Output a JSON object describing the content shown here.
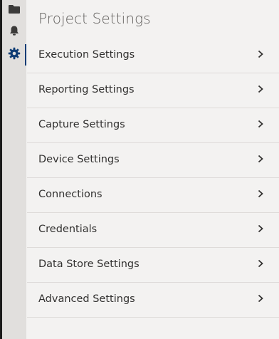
{
  "page_title": "Project Settings",
  "rail": {
    "items": [
      {
        "name": "folder-icon",
        "active": false
      },
      {
        "name": "bell-icon",
        "active": false
      },
      {
        "name": "gear-icon",
        "active": true
      }
    ]
  },
  "settings": {
    "items": [
      {
        "label": "Execution Settings"
      },
      {
        "label": "Reporting Settings"
      },
      {
        "label": "Capture Settings"
      },
      {
        "label": "Device Settings"
      },
      {
        "label": "Connections"
      },
      {
        "label": "Credentials"
      },
      {
        "label": "Data Store Settings"
      },
      {
        "label": "Advanced Settings"
      }
    ]
  },
  "colors": {
    "panel_bg": "#f3f2f1",
    "rail_bg": "#e1dfdd",
    "accent": "#0f3d75",
    "divider": "#dedbd9"
  }
}
